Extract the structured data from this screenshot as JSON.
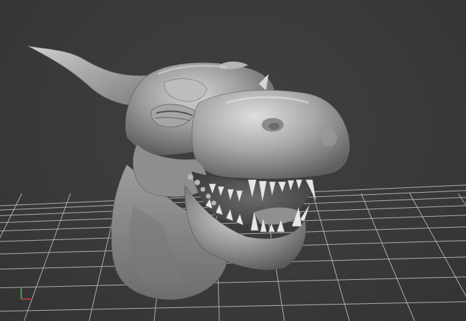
{
  "viewport": {
    "background": "#393939",
    "grid_color": "#c8c8c8",
    "model": "dragon-head-sculpt",
    "model_color": "#9a9a9a"
  },
  "axis_gizmo": {
    "x_color": "#e03a3a",
    "y_color": "#3ad13a"
  }
}
